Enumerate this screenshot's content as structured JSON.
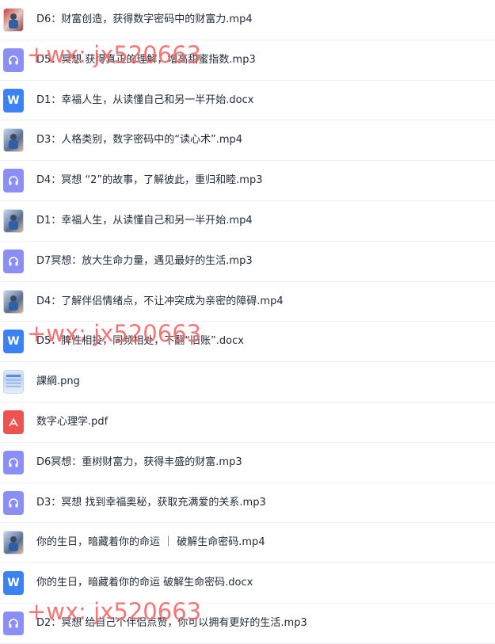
{
  "files": [
    {
      "type": "video-first",
      "name": "D6：财富创造，获得数字密码中的财富力.mp4"
    },
    {
      "type": "audio",
      "name": "D5：冥想 获得真正的理解，增高甜蜜指数.mp3"
    },
    {
      "type": "word",
      "name": "D1：幸福人生，从读懂自己和另一半开始.docx"
    },
    {
      "type": "video",
      "name": "D3：人格类别，数字密码中的“读心术”.mp4"
    },
    {
      "type": "audio",
      "name": "D4：冥想 “2”的故事，了解彼此，重归和睦.mp3"
    },
    {
      "type": "video",
      "name": "D1：幸福人生，从读懂自己和另一半开始.mp4"
    },
    {
      "type": "audio",
      "name": "D7冥想：放大生命力量，遇见最好的生活.mp3"
    },
    {
      "type": "video",
      "name": "D4：了解伴侣情绪点，不让冲突成为亲密的障碍.mp4"
    },
    {
      "type": "word",
      "name": "D5：脾性相投，同频相处，不翻“旧账”.docx"
    },
    {
      "type": "image",
      "name": "課綱.png"
    },
    {
      "type": "pdf",
      "name": "数字心理学.pdf"
    },
    {
      "type": "audio",
      "name": "D6冥想：重树财富力，获得丰盛的财富.mp3"
    },
    {
      "type": "audio",
      "name": "D3：冥想 找到幸福奥秘，获取充满爱的关系.mp3"
    },
    {
      "type": "video",
      "name": "你的生日，暗藏着你的命运 ｜ 破解生命密码.mp4"
    },
    {
      "type": "word",
      "name": "你的生日，暗藏着你的命运 破解生命密码.docx"
    },
    {
      "type": "audio",
      "name": "D2：冥想 给自己个伴侣点赞，你可以拥有更好的生活.mp3"
    }
  ],
  "watermark": "+wx: jx520663",
  "icons": {
    "audio": "headphone-icon",
    "word": "word-doc-icon",
    "pdf": "pdf-icon",
    "video": "video-thumbnail",
    "image": "image-thumbnail"
  }
}
